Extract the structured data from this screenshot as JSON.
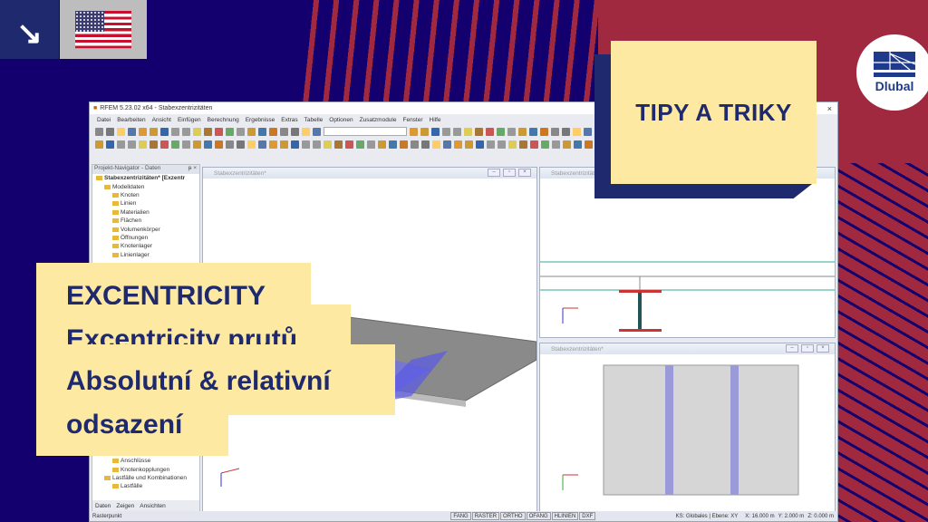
{
  "thumbnail": {
    "badge": "TIPY A TRIKY",
    "brand": "Dlubal",
    "headline": [
      "EXCENTRICITY",
      "Excentricity prutů",
      "Absolutní & relativní",
      "odsazení"
    ],
    "language_flag": "us-flag-icon"
  },
  "app": {
    "title": "RFEM 5.23.02 x64 - Stabexzentrizitäten",
    "menu": [
      "Datei",
      "Bearbeiten",
      "Ansicht",
      "Einfügen",
      "Berechnung",
      "Ergebnisse",
      "Extras",
      "Tabelle",
      "Optionen",
      "Zusatzmodule",
      "Fenster",
      "Hilfe"
    ],
    "navigator": {
      "title": "Projekt-Navigator - Daten",
      "pin": "ᵽ ×",
      "items": [
        {
          "label": "Stabexzentrizitäten* [Exzentr",
          "level": 0
        },
        {
          "label": "Modelldaten",
          "level": 1
        },
        {
          "label": "Knoten",
          "level": 2
        },
        {
          "label": "Linien",
          "level": 2
        },
        {
          "label": "Materialien",
          "level": 2
        },
        {
          "label": "Flächen",
          "level": 2
        },
        {
          "label": "Volumenkörper",
          "level": 2
        },
        {
          "label": "Öffnungen",
          "level": 2
        },
        {
          "label": "Knotenlager",
          "level": 2
        },
        {
          "label": "Linienlager",
          "level": 2
        }
      ],
      "items_bottom": [
        {
          "label": "Anschlüsse",
          "level": 2
        },
        {
          "label": "Knotenkopplungen",
          "level": 2
        },
        {
          "label": "Lastfälle und Kombinationen",
          "level": 1
        },
        {
          "label": "Lastfälle",
          "level": 2
        }
      ],
      "tabs": [
        "Daten",
        "Zeigen",
        "Ansichten"
      ]
    },
    "views": [
      {
        "title": "Stabexzentrizitäten*"
      },
      {
        "title": "Stabexzentrizitäten*"
      },
      {
        "title": "Stabexzentrizitäten*"
      }
    ],
    "status": {
      "left": "Rasterpunkt",
      "toggles": [
        "FANG",
        "RASTER",
        "ORTHO",
        "OFANG",
        "HLINIEN",
        "DXF"
      ],
      "cs": "KS: Globales | Ebene: XY",
      "x": "X: 16.000 m",
      "y": "Y: 2.000 m",
      "z": "Z: 0.000 m"
    }
  },
  "colors": {
    "navy": "#13006e",
    "red": "#a0283f",
    "yellow": "#fde9a2",
    "text": "#1f2a6e"
  }
}
